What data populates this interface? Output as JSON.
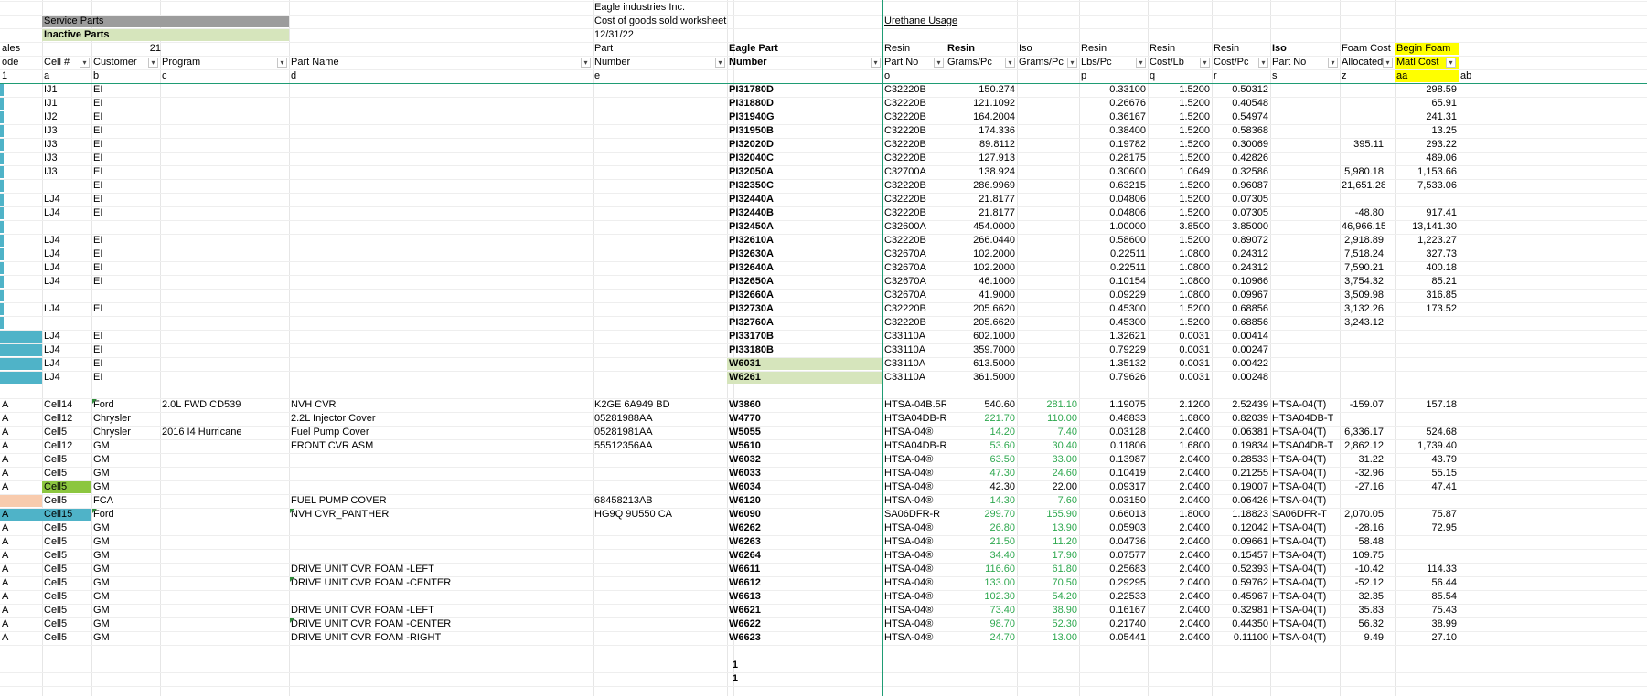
{
  "colors": {
    "gray_header": "#9c9c9c",
    "light_green": "#d6e5bc",
    "bright_green": "#8cc63f",
    "teal": "#4fb3c8",
    "peach": "#f8cbad",
    "yellow": "#ffff00",
    "green_text": "#2ea84f",
    "freeze_line": "#1f9c74"
  },
  "top": {
    "service_parts": "Service Parts",
    "inactive_parts": "Inactive Parts",
    "company": "Eagle industries Inc.",
    "worksheet": "Cost of goods sold worksheet",
    "date": "12/31/22",
    "urethane": "Urethane Usage"
  },
  "hdr1": {
    "sales": "ales",
    "count": "21",
    "part": "Part",
    "eagle": "Eagle Part",
    "resin": "Resin",
    "resin_g": "Resin",
    "iso": "Iso",
    "resin_lbs": "Resin",
    "resin_costlb": "Resin",
    "resin_costpc": "Resin",
    "iso_part": "Iso",
    "foam": "Foam Cost",
    "begin": "Begin Foam"
  },
  "hdr2": {
    "code": "ode",
    "cell": "Cell #",
    "customer": "Customer",
    "program": "Program",
    "part_name": "Part Name",
    "number": "Number",
    "eagle_number": "Number",
    "resin_part": "Part No",
    "grams": "Grams/Pc",
    "iso_grams": "Grams/Pc",
    "lbs": "Lbs/Pc",
    "cost_lb": "Cost/Lb",
    "cost_pc": "Cost/Pc",
    "iso_part_no": "Part No",
    "allocated": "Allocated",
    "matl": "Matl Cost"
  },
  "letters": {
    "c0": "1",
    "c1": "a",
    "c2": "b",
    "c3": "c",
    "c4": "d",
    "c5": "e",
    "c7": "o",
    "c10": "p",
    "c11": "q",
    "c12": "r",
    "c13": "s",
    "c14": "z",
    "c15": "aa",
    "c16": "ab"
  },
  "rows": [
    {
      "cell": "IJ1",
      "cust": "EI",
      "eagle": "PI31780D",
      "resin": "C32220B",
      "grams": "150.274",
      "lbs": "0.33100",
      "clb": "1.5200",
      "cpc": "0.50312",
      "foam": "",
      "matl": "298.59"
    },
    {
      "cell": "IJ1",
      "cust": "EI",
      "eagle": "PI31880D",
      "resin": "C32220B",
      "grams": "121.1092",
      "lbs": "0.26676",
      "clb": "1.5200",
      "cpc": "0.40548",
      "foam": "",
      "matl": "65.91"
    },
    {
      "cell": "IJ2",
      "cust": "EI",
      "eagle": "PI31940G",
      "resin": "C32220B",
      "grams": "164.2004",
      "lbs": "0.36167",
      "clb": "1.5200",
      "cpc": "0.54974",
      "foam": "",
      "matl": "241.31"
    },
    {
      "cell": "IJ3",
      "cust": "EI",
      "eagle": "PI31950B",
      "resin": "C32220B",
      "grams": "174.336",
      "lbs": "0.38400",
      "clb": "1.5200",
      "cpc": "0.58368",
      "foam": "",
      "matl": "13.25"
    },
    {
      "cell": "IJ3",
      "cust": "EI",
      "eagle": "PI32020D",
      "resin": "C32220B",
      "grams": "89.8112",
      "lbs": "0.19782",
      "clb": "1.5200",
      "cpc": "0.30069",
      "foam": "395.11",
      "matl": "293.22"
    },
    {
      "cell": "IJ3",
      "cust": "EI",
      "eagle": "PI32040C",
      "resin": "C32220B",
      "grams": "127.913",
      "lbs": "0.28175",
      "clb": "1.5200",
      "cpc": "0.42826",
      "foam": "",
      "matl": "489.06"
    },
    {
      "cell": "IJ3",
      "cust": "EI",
      "eagle": "PI32050A",
      "resin": "C32700A",
      "grams": "138.924",
      "lbs": "0.30600",
      "clb": "1.0649",
      "cpc": "0.32586",
      "foam": "5,980.18",
      "matl": "1,153.66"
    },
    {
      "cell": "",
      "cust": "EI",
      "eagle": "PI32350C",
      "resin": "C32220B",
      "grams": "286.9969",
      "lbs": "0.63215",
      "clb": "1.5200",
      "cpc": "0.96087",
      "foam": "21,651.28",
      "matl": "7,533.06"
    },
    {
      "cell": "LJ4",
      "cust": "EI",
      "eagle": "PI32440A",
      "resin": "C32220B",
      "grams": "21.8177",
      "lbs": "0.04806",
      "clb": "1.5200",
      "cpc": "0.07305",
      "foam": "",
      "matl": ""
    },
    {
      "cell": "LJ4",
      "cust": "EI",
      "eagle": "PI32440B",
      "resin": "C32220B",
      "grams": "21.8177",
      "lbs": "0.04806",
      "clb": "1.5200",
      "cpc": "0.07305",
      "foam": "-48.80",
      "matl": "917.41"
    },
    {
      "cell": "",
      "cust": "",
      "eagle": "PI32450A",
      "resin": "C32600A",
      "grams": "454.0000",
      "lbs": "1.00000",
      "clb": "3.8500",
      "cpc": "3.85000",
      "foam": "46,966.15",
      "matl": "13,141.30"
    },
    {
      "cell": "LJ4",
      "cust": "EI",
      "eagle": "PI32610A",
      "resin": "C32220B",
      "grams": "266.0440",
      "lbs": "0.58600",
      "clb": "1.5200",
      "cpc": "0.89072",
      "foam": "2,918.89",
      "matl": "1,223.27"
    },
    {
      "cell": "LJ4",
      "cust": "EI",
      "eagle": "PI32630A",
      "resin": "C32670A",
      "grams": "102.2000",
      "lbs": "0.22511",
      "clb": "1.0800",
      "cpc": "0.24312",
      "foam": "7,518.24",
      "matl": "327.73"
    },
    {
      "cell": "LJ4",
      "cust": "EI",
      "eagle": "PI32640A",
      "resin": "C32670A",
      "grams": "102.2000",
      "lbs": "0.22511",
      "clb": "1.0800",
      "cpc": "0.24312",
      "foam": "7,590.21",
      "matl": "400.18"
    },
    {
      "cell": "LJ4",
      "cust": "EI",
      "eagle": "PI32650A",
      "resin": "C32670A",
      "grams": "46.1000",
      "lbs": "0.10154",
      "clb": "1.0800",
      "cpc": "0.10966",
      "foam": "3,754.32",
      "matl": "85.21"
    },
    {
      "cell": "",
      "cust": "",
      "eagle": "PI32660A",
      "resin": "C32670A",
      "grams": "41.9000",
      "lbs": "0.09229",
      "clb": "1.0800",
      "cpc": "0.09967",
      "foam": "3,509.98",
      "matl": "316.85"
    },
    {
      "cell": "LJ4",
      "cust": "EI",
      "eagle": "PI32730A",
      "resin": "C32220B",
      "grams": "205.6620",
      "lbs": "0.45300",
      "clb": "1.5200",
      "cpc": "0.68856",
      "foam": "3,132.26",
      "matl": "173.52"
    },
    {
      "cell": "",
      "cust": "",
      "eagle": "PI32760A",
      "resin": "C32220B",
      "grams": "205.6620",
      "lbs": "0.45300",
      "clb": "1.5200",
      "cpc": "0.68856",
      "foam": "3,243.12",
      "matl": ""
    },
    {
      "cell": "LJ4",
      "cust": "EI",
      "eagle": "PI33170B",
      "resin": "C33110A",
      "grams": "602.1000",
      "lbs": "1.32621",
      "clb": "0.0031",
      "cpc": "0.00414",
      "foam": "",
      "matl": ""
    },
    {
      "cell": "LJ4",
      "cust": "EI",
      "eagle": "PI33180B",
      "resin": "C33110A",
      "grams": "359.7000",
      "lbs": "0.79229",
      "clb": "0.0031",
      "cpc": "0.00247",
      "foam": "",
      "matl": ""
    },
    {
      "cell": "LJ4",
      "cust": "EI",
      "eagle": "W6031",
      "resin": "C33110A",
      "grams": "613.5000",
      "lbs": "1.35132",
      "clb": "0.0031",
      "cpc": "0.00422",
      "foam": "",
      "matl": ""
    },
    {
      "cell": "LJ4",
      "cust": "EI",
      "eagle": "W6261",
      "resin": "C33110A",
      "grams": "361.5000",
      "lbs": "0.79626",
      "clb": "0.0031",
      "cpc": "0.00248",
      "foam": "",
      "matl": ""
    }
  ],
  "rows2": [
    {
      "code": "A",
      "cell": "Cell14",
      "cust": "Ford",
      "prog": "2.0L FWD CD539",
      "name": "NVH CVR",
      "num": "K2GE 6A949 BD",
      "eagle": "W3860",
      "resin": "HTSA-04B.5R",
      "grams": "540.60",
      "iso": "281.10",
      "lbs": "1.19075",
      "clb": "2.1200",
      "cpc": "2.52439",
      "isop": "HTSA-04(T)",
      "foam": "-159.07",
      "matl": "157.18"
    },
    {
      "code": "A",
      "cell": "Cell12",
      "cust": "Chrysler",
      "prog": "",
      "name": "2.2L Injector Cover",
      "num": "05281988AA",
      "eagle": "W4770",
      "resin": "HTSA04DB-R",
      "grams": "221.70",
      "iso": "110.00",
      "lbs": "0.48833",
      "clb": "1.6800",
      "cpc": "0.82039",
      "isop": "HTSA04DB-T",
      "foam": "",
      "matl": ""
    },
    {
      "code": "A",
      "cell": "Cell5",
      "cust": "Chrysler",
      "prog": "2016 I4 Hurricane",
      "name": "Fuel Pump Cover",
      "num": "05281981AA",
      "eagle": "W5055",
      "resin": "HTSA-04®",
      "grams": "14.20",
      "iso": "7.40",
      "lbs": "0.03128",
      "clb": "2.0400",
      "cpc": "0.06381",
      "isop": "HTSA-04(T)",
      "foam": "6,336.17",
      "matl": "524.68"
    },
    {
      "code": "A",
      "cell": "Cell12",
      "cust": "GM",
      "prog": "",
      "name": "FRONT CVR ASM",
      "num": "55512356AA",
      "eagle": "W5610",
      "resin": "HTSA04DB-R",
      "grams": "53.60",
      "iso": "30.40",
      "lbs": "0.11806",
      "clb": "1.6800",
      "cpc": "0.19834",
      "isop": "HTSA04DB-T",
      "foam": "2,862.12",
      "matl": "1,739.40"
    },
    {
      "code": "A",
      "cell": "Cell5",
      "cust": "GM",
      "prog": "",
      "name": "",
      "num": "",
      "eagle": "W6032",
      "resin": "HTSA-04®",
      "grams": "63.50",
      "iso": "33.00",
      "lbs": "0.13987",
      "clb": "2.0400",
      "cpc": "0.28533",
      "isop": "HTSA-04(T)",
      "foam": "31.22",
      "matl": "43.79"
    },
    {
      "code": "A",
      "cell": "Cell5",
      "cust": "GM",
      "prog": "",
      "name": "",
      "num": "",
      "eagle": "W6033",
      "resin": "HTSA-04®",
      "grams": "47.30",
      "iso": "24.60",
      "lbs": "0.10419",
      "clb": "2.0400",
      "cpc": "0.21255",
      "isop": "HTSA-04(T)",
      "foam": "-32.96",
      "matl": "55.15"
    },
    {
      "code": "A",
      "cell": "Cell5",
      "cust": "GM",
      "prog": "",
      "name": "",
      "num": "",
      "eagle": "W6034",
      "resin": "HTSA-04®",
      "grams": "42.30",
      "iso": "22.00",
      "lbs": "0.09317",
      "clb": "2.0400",
      "cpc": "0.19007",
      "isop": "HTSA-04(T)",
      "foam": "-27.16",
      "matl": "47.41"
    },
    {
      "code": "",
      "cell": "Cell5",
      "cust": "FCA",
      "prog": "",
      "name": "FUEL PUMP COVER",
      "num": "68458213AB",
      "eagle": "W6120",
      "resin": "HTSA-04®",
      "grams": "14.30",
      "iso": "7.60",
      "lbs": "0.03150",
      "clb": "2.0400",
      "cpc": "0.06426",
      "isop": "HTSA-04(T)",
      "foam": "",
      "matl": ""
    },
    {
      "code": "A",
      "cell": "Cell15",
      "cust": "Ford",
      "prog": "",
      "name": "NVH CVR_PANTHER",
      "num": "HG9Q 9U550 CA",
      "eagle": "W6090",
      "resin": "SA06DFR-R",
      "grams": "299.70",
      "iso": "155.90",
      "lbs": "0.66013",
      "clb": "1.8000",
      "cpc": "1.18823",
      "isop": "SA06DFR-T",
      "foam": "2,070.05",
      "matl": "75.87"
    },
    {
      "code": "A",
      "cell": "Cell5",
      "cust": "GM",
      "prog": "",
      "name": "",
      "num": "",
      "eagle": "W6262",
      "resin": "HTSA-04®",
      "grams": "26.80",
      "iso": "13.90",
      "lbs": "0.05903",
      "clb": "2.0400",
      "cpc": "0.12042",
      "isop": "HTSA-04(T)",
      "foam": "-28.16",
      "matl": "72.95"
    },
    {
      "code": "A",
      "cell": "Cell5",
      "cust": "GM",
      "prog": "",
      "name": "",
      "num": "",
      "eagle": "W6263",
      "resin": "HTSA-04®",
      "grams": "21.50",
      "iso": "11.20",
      "lbs": "0.04736",
      "clb": "2.0400",
      "cpc": "0.09661",
      "isop": "HTSA-04(T)",
      "foam": "58.48",
      "matl": ""
    },
    {
      "code": "A",
      "cell": "Cell5",
      "cust": "GM",
      "prog": "",
      "name": "",
      "num": "",
      "eagle": "W6264",
      "resin": "HTSA-04®",
      "grams": "34.40",
      "iso": "17.90",
      "lbs": "0.07577",
      "clb": "2.0400",
      "cpc": "0.15457",
      "isop": "HTSA-04(T)",
      "foam": "109.75",
      "matl": ""
    },
    {
      "code": "A",
      "cell": "Cell5",
      "cust": "GM",
      "prog": "",
      "name": "DRIVE UNIT CVR FOAM -LEFT",
      "num": "",
      "eagle": "W6611",
      "resin": "HTSA-04®",
      "grams": "116.60",
      "iso": "61.80",
      "lbs": "0.25683",
      "clb": "2.0400",
      "cpc": "0.52393",
      "isop": "HTSA-04(T)",
      "foam": "-10.42",
      "matl": "114.33"
    },
    {
      "code": "A",
      "cell": "Cell5",
      "cust": "GM",
      "prog": "",
      "name": "DRIVE UNIT CVR FOAM -CENTER",
      "num": "",
      "eagle": "W6612",
      "resin": "HTSA-04®",
      "grams": "133.00",
      "iso": "70.50",
      "lbs": "0.29295",
      "clb": "2.0400",
      "cpc": "0.59762",
      "isop": "HTSA-04(T)",
      "foam": "-52.12",
      "matl": "56.44"
    },
    {
      "code": "A",
      "cell": "Cell5",
      "cust": "GM",
      "prog": "",
      "name": "",
      "num": "",
      "eagle": "W6613",
      "resin": "HTSA-04®",
      "grams": "102.30",
      "iso": "54.20",
      "lbs": "0.22533",
      "clb": "2.0400",
      "cpc": "0.45967",
      "isop": "HTSA-04(T)",
      "foam": "32.35",
      "matl": "85.54"
    },
    {
      "code": "A",
      "cell": "Cell5",
      "cust": "GM",
      "prog": "",
      "name": "DRIVE UNIT CVR FOAM -LEFT",
      "num": "",
      "eagle": "W6621",
      "resin": "HTSA-04®",
      "grams": "73.40",
      "iso": "38.90",
      "lbs": "0.16167",
      "clb": "2.0400",
      "cpc": "0.32981",
      "isop": "HTSA-04(T)",
      "foam": "35.83",
      "matl": "75.43"
    },
    {
      "code": "A",
      "cell": "Cell5",
      "cust": "GM",
      "prog": "",
      "name": "DRIVE UNIT CVR FOAM -CENTER",
      "num": "",
      "eagle": "W6622",
      "resin": "HTSA-04®",
      "grams": "98.70",
      "iso": "52.30",
      "lbs": "0.21740",
      "clb": "2.0400",
      "cpc": "0.44350",
      "isop": "HTSA-04(T)",
      "foam": "56.32",
      "matl": "38.99"
    },
    {
      "code": "A",
      "cell": "Cell5",
      "cust": "GM",
      "prog": "",
      "name": "DRIVE UNIT CVR FOAM -RIGHT",
      "num": "",
      "eagle": "W6623",
      "resin": "HTSA-04®",
      "grams": "24.70",
      "iso": "13.00",
      "lbs": "0.05441",
      "clb": "2.0400",
      "cpc": "0.11100",
      "isop": "HTSA-04(T)",
      "foam": "9.49",
      "matl": "27.10"
    }
  ],
  "bottom": [
    "1",
    "1"
  ]
}
